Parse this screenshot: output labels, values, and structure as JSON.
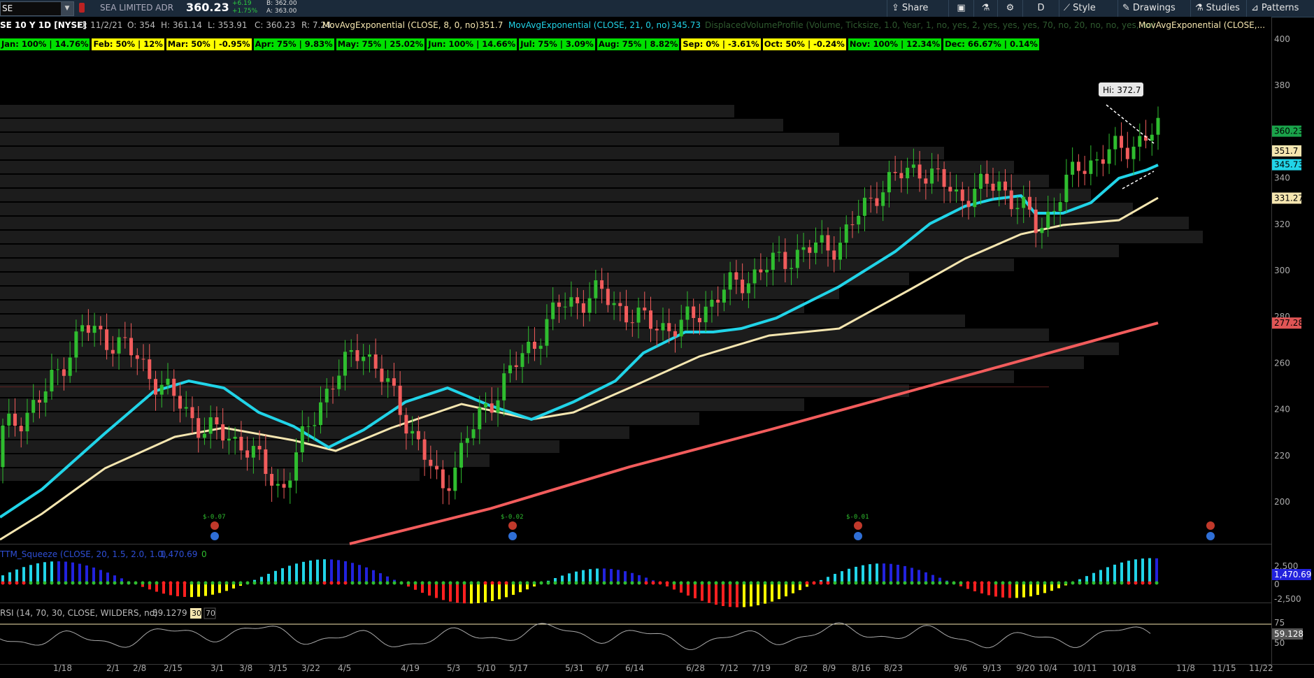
{
  "toolbar": {
    "symbol": "SE",
    "company": "SEA LIMITED ADR",
    "last": "360.23",
    "change": "+6.19",
    "change_pct": "+1.75%",
    "bid": "B: 362.00",
    "ask": "A: 363.00",
    "share": "Share",
    "period": "D",
    "style": "Style",
    "drawings": "Drawings",
    "studies": "Studies",
    "patterns": "Patterns",
    "colors": {
      "bar": "#1b2a3a",
      "accent": "#2ecc40"
    }
  },
  "infoline": {
    "title": "SE 10 Y 1D [NYSE]",
    "date": "D: 11/2/21",
    "open": "O: 354",
    "high": "H: 361.14",
    "low": "L: 353.91",
    "close": "C: 360.23",
    "range": "R: 7.24",
    "ema8": "MovAvgExponential (CLOSE, 8, 0, no)",
    "ema8_val": "351.7",
    "ema21": "MovAvgExponential (CLOSE, 21, 0, no)",
    "ema21_val": "345.73",
    "dvp": "DisplacedVolumeProfile (Volume, Ticksize, 1.0, Year, 1, no, yes, 2, yes, yes, yes, 70, no, 20, no, no, yes, no)",
    "ema_more": "MovAvgExponential (CLOSE,..."
  },
  "seasonality": [
    {
      "label": "Jan: 100% | 14.76%",
      "color": "#00e000"
    },
    {
      "label": "Feb: 50% | 12%",
      "color": "#ffff00"
    },
    {
      "label": "Mar: 50% | -0.95%",
      "color": "#ffff00"
    },
    {
      "label": "Apr: 75% | 9.83%",
      "color": "#00e000"
    },
    {
      "label": "May: 75% | 25.02%",
      "color": "#00e000"
    },
    {
      "label": "Jun: 100% | 14.66%",
      "color": "#00e000"
    },
    {
      "label": "Jul: 75% | 3.09%",
      "color": "#00e000"
    },
    {
      "label": "Aug: 75% | 8.82%",
      "color": "#00e000"
    },
    {
      "label": "Sep: 0% | -3.61%",
      "color": "#ffff00"
    },
    {
      "label": "Oct: 50% | -0.24%",
      "color": "#ffff00"
    },
    {
      "label": "Nov: 100% | 12.34%",
      "color": "#00e000"
    },
    {
      "label": "Dec: 66.67% | 0.14%",
      "color": "#00e000"
    }
  ],
  "price_axis": [
    "400",
    "380",
    "360",
    "340",
    "320",
    "300",
    "280",
    "260",
    "240",
    "220",
    "200"
  ],
  "price_tags": [
    {
      "text": "360.23",
      "price": 360.23,
      "bg": "#1aa34a",
      "fg": "#000"
    },
    {
      "text": "351.7",
      "price": 351.7,
      "bg": "#f5e6b0",
      "fg": "#000"
    },
    {
      "text": "345.73",
      "price": 345.73,
      "bg": "#21d4e8",
      "fg": "#000"
    },
    {
      "text": "331.27",
      "price": 331.27,
      "bg": "#f5e6b0",
      "fg": "#000"
    },
    {
      "text": "277.28",
      "price": 277.28,
      "bg": "#e05555",
      "fg": "#000"
    }
  ],
  "hi_label": "Hi: 372.7",
  "dividends": [
    "$-0.07",
    "$-0.02",
    "$-0.01"
  ],
  "date_axis": [
    "1/18",
    "2/1",
    "2/8",
    "2/15",
    "3/1",
    "3/8",
    "3/15",
    "3/22",
    "4/5",
    "4/19",
    "5/3",
    "5/10",
    "5/17",
    "5/31",
    "6/7",
    "6/14",
    "6/28",
    "7/12",
    "7/19",
    "8/2",
    "8/9",
    "8/16",
    "8/23",
    "9/6",
    "9/13",
    "9/20",
    "10/4",
    "10/11",
    "10/18",
    "11/8",
    "11/15",
    "11/22"
  ],
  "squeeze": {
    "label": "TTM_Squeeze (CLOSE, 20, 1.5, 2.0, 1.0)",
    "val1": "1,470.69",
    "val2": "0",
    "axis_top": "2,500",
    "axis_mid": "0",
    "axis_bot": "-2,500",
    "tag": "1,470.69"
  },
  "rsi": {
    "label": "RSI (14, 70, 30, CLOSE, WILDERS, no)",
    "val": "59.1279",
    "lo": "30",
    "hi": "70",
    "axis_top": "75",
    "axis_bot": "50",
    "tag": "59.128"
  },
  "chart_data": {
    "type": "candlestick",
    "x": [
      "1/18",
      "2/1",
      "2/8",
      "2/15",
      "3/1",
      "3/8",
      "3/15",
      "3/22",
      "4/5",
      "4/19",
      "5/3",
      "5/10",
      "5/17",
      "5/31",
      "6/7",
      "6/14",
      "6/28",
      "7/12",
      "7/19",
      "8/2",
      "8/9",
      "8/16",
      "8/23",
      "9/6",
      "9/13",
      "9/20",
      "10/4",
      "10/11",
      "10/18",
      "11/2"
    ],
    "close": [
      230,
      245,
      275,
      268,
      250,
      232,
      226,
      205,
      245,
      268,
      240,
      205,
      238,
      262,
      285,
      290,
      278,
      275,
      290,
      300,
      308,
      312,
      336,
      345,
      332,
      338,
      318,
      345,
      352,
      360.23
    ],
    "ema8_last": 351.7,
    "ema21_last": 345.73,
    "ema50_last": 331.27,
    "ema200_last": 277.28,
    "high_marker": 372.7,
    "ylim": [
      190,
      402
    ]
  }
}
